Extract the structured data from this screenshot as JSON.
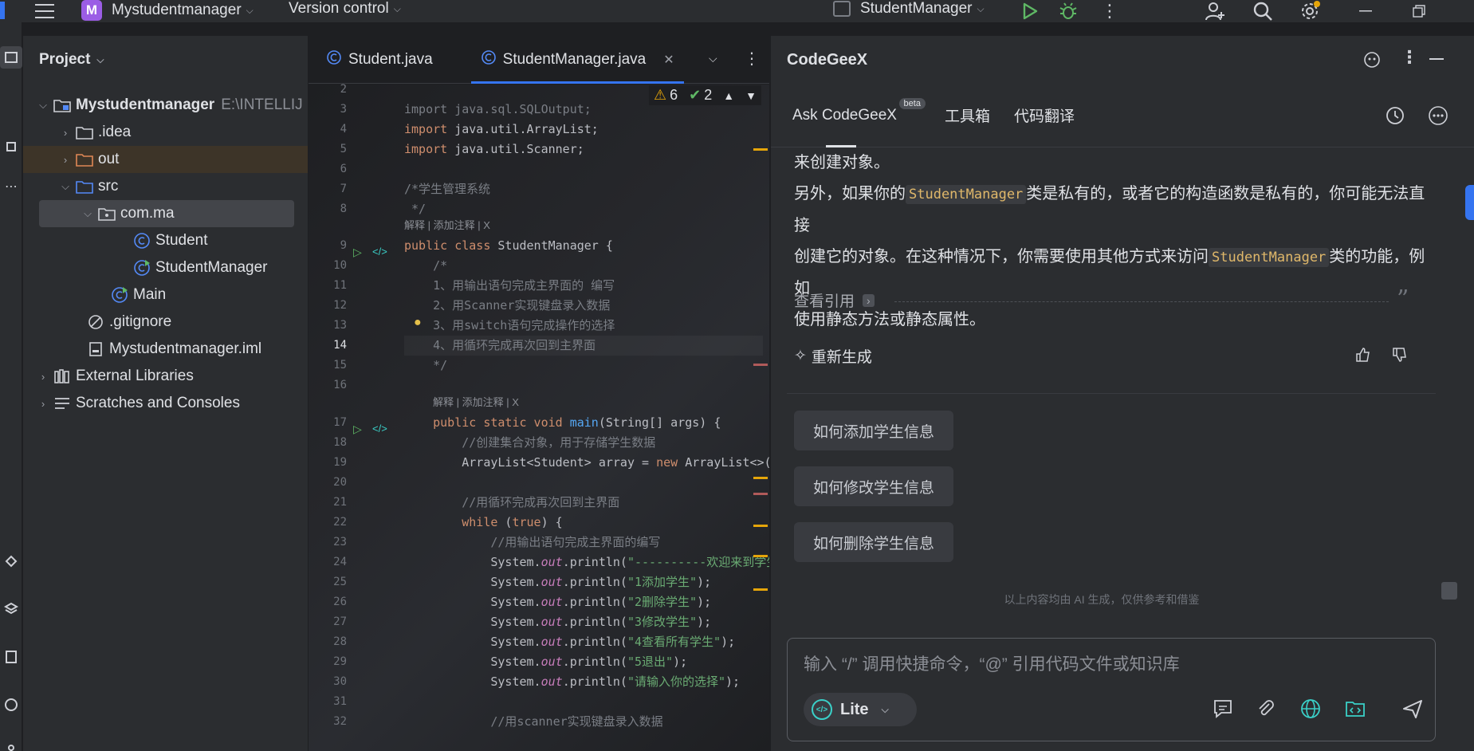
{
  "titlebar": {
    "project_letter": "M",
    "project_name": "Mystudentmanager",
    "vcs": "Version control",
    "run_config": "StudentManager"
  },
  "project_panel": {
    "title": "Project",
    "tree": [
      {
        "label": "Mystudentmanager",
        "suffix": "E:\\INTELLIJ",
        "icon": "module-folder-icon"
      },
      {
        "label": ".idea",
        "icon": "folder-icon"
      },
      {
        "label": "out",
        "icon": "folder-icon"
      },
      {
        "label": "src",
        "icon": "source-folder-icon"
      },
      {
        "label": "com.ma",
        "icon": "package-icon"
      },
      {
        "label": "Student",
        "icon": "class-icon"
      },
      {
        "label": "StudentManager",
        "icon": "class-icon"
      },
      {
        "label": "Main",
        "icon": "class-icon"
      },
      {
        "label": ".gitignore",
        "icon": "ignore-file-icon"
      },
      {
        "label": "Mystudentmanager.iml",
        "icon": "iml-file-icon"
      },
      {
        "label": "External Libraries",
        "icon": "library-icon"
      },
      {
        "label": "Scratches and Consoles",
        "icon": "scratches-icon"
      }
    ]
  },
  "editor": {
    "tabs": [
      {
        "label": "Student.java"
      },
      {
        "label": "StudentManager.java"
      }
    ],
    "warnings": "6",
    "ok": "2",
    "hint_text": "解释 | 添加注释 | X",
    "line_numbers": [
      "2",
      "3",
      "4",
      "5",
      "6",
      "7",
      "8",
      "9",
      "10",
      "11",
      "12",
      "13",
      "14",
      "15",
      "16",
      "17",
      "18",
      "19",
      "20",
      "21",
      "22",
      "23",
      "24",
      "25",
      "26",
      "27",
      "28",
      "29",
      "30",
      "31",
      "32"
    ]
  },
  "codegeex": {
    "title": "CodeGeeX",
    "tabs": [
      {
        "label": "Ask CodeGeeX"
      },
      {
        "label": "工具箱"
      },
      {
        "label": "代码翻译"
      }
    ],
    "beta": "beta",
    "answer_line1": "来创建对象。",
    "answer_p2_a": "另外，如果你的",
    "answer_code1": "StudentManager",
    "answer_p2_b": "类是私有的，或者它的构造函数是私有的，你可能无法直接",
    "answer_p2_c": "创建它的对象。在这种情况下，你需要使用其他方式来访问",
    "answer_code2": "StudentManager",
    "answer_p2_d": "类的功能，例如",
    "answer_p2_e": "使用静态方法或静态属性。",
    "view_refs": "查看引用",
    "regenerate": "重新生成",
    "suggestions": [
      "如何添加学生信息",
      "如何修改学生信息",
      "如何删除学生信息"
    ],
    "disclaimer": "以上内容均由 AI 生成，仅供参考和借鉴",
    "input_placeholder": "输入 “/” 调用快捷命令，“@” 引用代码文件或知识库",
    "model": "Lite"
  }
}
